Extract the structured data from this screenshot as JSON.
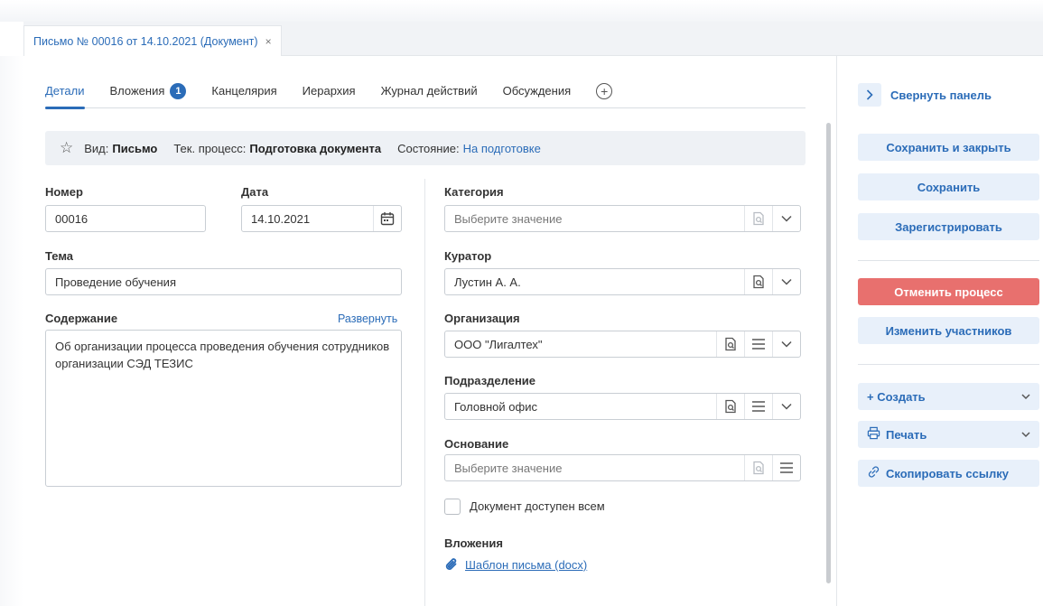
{
  "doc_tab": {
    "title": "Письмо № 00016 от 14.10.2021 (Документ)",
    "close": "×"
  },
  "tabs": [
    {
      "label": "Детали"
    },
    {
      "label": "Вложения",
      "badge": "1"
    },
    {
      "label": "Канцелярия"
    },
    {
      "label": "Иерархия"
    },
    {
      "label": "Журнал действий"
    },
    {
      "label": "Обсуждения"
    }
  ],
  "infobar": {
    "kind_label": "Вид:",
    "kind_value": "Письмо",
    "process_label": "Тек. процесс:",
    "process_value": "Подготовка документа",
    "state_label": "Состояние:",
    "state_value": "На подготовке"
  },
  "form": {
    "number": {
      "label": "Номер",
      "value": "00016"
    },
    "date": {
      "label": "Дата",
      "value": "14.10.2021"
    },
    "topic": {
      "label": "Тема",
      "value": "Проведение обучения"
    },
    "content": {
      "label": "Содержание",
      "expand": "Развернуть",
      "value": "Об организации процесса проведения обучения сотрудников организации СЭД ТЕЗИС"
    },
    "category": {
      "label": "Категория",
      "placeholder": "Выберите значение"
    },
    "curator": {
      "label": "Куратор",
      "value": "Лустин А. А."
    },
    "organization": {
      "label": "Организация",
      "value": "ООО \"Лигалтех\""
    },
    "department": {
      "label": "Подразделение",
      "value": "Головной офис"
    },
    "basis": {
      "label": "Основание",
      "placeholder": "Выберите значение"
    },
    "public_checkbox": {
      "label": "Документ доступен всем",
      "checked": false
    },
    "attachments": {
      "label": "Вложения",
      "file": "Шаблон письма (docx)"
    }
  },
  "right_panel": {
    "collapse": "Свернуть панель",
    "save_close": "Сохранить и закрыть",
    "save": "Сохранить",
    "register": "Зарегистрировать",
    "cancel_process": "Отменить процесс",
    "change_participants": "Изменить участников",
    "create": "+ Создать",
    "print": "Печать",
    "copy_link": "Скопировать ссылку"
  },
  "colors": {
    "accent": "#2b6cb8",
    "danger": "#e8706e",
    "button_bg": "#e8f0fa"
  }
}
